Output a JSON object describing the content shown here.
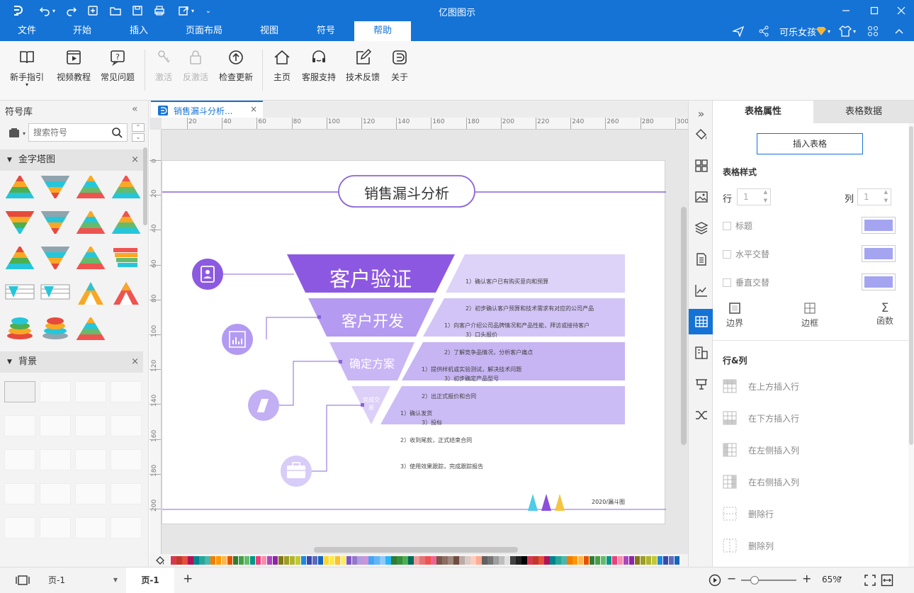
{
  "app": {
    "title": "亿图图示"
  },
  "menu": {
    "tabs": [
      {
        "label": "文件"
      },
      {
        "label": "开始"
      },
      {
        "label": "插入"
      },
      {
        "label": "页面布局"
      },
      {
        "label": "视图"
      },
      {
        "label": "符号"
      },
      {
        "label": "帮助"
      }
    ],
    "active_tab": "帮助",
    "user_name": "可乐女孩"
  },
  "ribbon": {
    "buttons": [
      {
        "label": "新手指引",
        "icon": "book-icon"
      },
      {
        "label": "视频教程",
        "icon": "video-icon"
      },
      {
        "label": "常见问题",
        "icon": "question-icon"
      },
      {
        "label": "激活",
        "icon": "key-icon",
        "disabled": true
      },
      {
        "label": "反激活",
        "icon": "lock-icon",
        "disabled": true
      },
      {
        "label": "检查更新",
        "icon": "upload-circle-icon"
      },
      {
        "label": "主页",
        "icon": "home-icon"
      },
      {
        "label": "客服支持",
        "icon": "headset-icon"
      },
      {
        "label": "技术反馈",
        "icon": "feedback-edit-icon"
      },
      {
        "label": "关于",
        "icon": "logo-icon"
      }
    ]
  },
  "symbol_library": {
    "title": "符号库",
    "search_placeholder": "搜索符号",
    "sections": [
      {
        "title": "金字塔图"
      },
      {
        "title": "背景"
      }
    ]
  },
  "doc_tab": {
    "label": "销售漏斗分析..."
  },
  "ruler": {
    "h_ticks": [
      "20",
      "40",
      "60",
      "80",
      "100",
      "120",
      "140",
      "160",
      "180",
      "200",
      "220",
      "240",
      "260",
      "280",
      "300"
    ],
    "v_ticks": [
      "0",
      "20",
      "40",
      "60",
      "80",
      "100",
      "120",
      "140",
      "160",
      "180",
      "200"
    ]
  },
  "diagram": {
    "title": "销售漏斗分析",
    "footer": "2020/漏斗图",
    "stages": [
      {
        "name": "客户验证",
        "lines": [
          "1）确认客户已有购买意向和预算",
          "2）初步确认客户预算和技术需求有对应的公司产品",
          "3）口头报价"
        ]
      },
      {
        "name": "客户开发",
        "lines": [
          "1）向客户介绍公司品牌情况和产品性能，拜访或接待客户",
          "2）了解竞争品情况，分析客户痛点",
          "3）初步确定产品型号"
        ]
      },
      {
        "name": "确定方案",
        "lines": [
          "1）提供样机或实验测试，解决技术问题",
          "2）出正式报价和合同",
          "3）投标"
        ]
      },
      {
        "name": "完成交易",
        "lines": [
          "1）确认发货",
          "2）收到尾款，正式结束合同",
          "3）使用效果跟踪，完成跟踪报告"
        ]
      }
    ],
    "colors": {
      "stage1": "#8d58e1",
      "stage2": "#b49af0",
      "stage3": "#c9b6f4",
      "stage4": "#dccff8",
      "desc_bg": "#ddd2f8",
      "line": "#8c64d8"
    }
  },
  "right_panel": {
    "tabs": [
      {
        "label": "表格属性"
      },
      {
        "label": "表格数据"
      }
    ],
    "insert_table": "插入表格",
    "table_style": "表格样式",
    "row_label": "行",
    "row_value": "1",
    "col_label": "列",
    "col_value": "1",
    "options": [
      {
        "label": "标题",
        "color": "#a4a4f0"
      },
      {
        "label": "水平交替",
        "color": "#a4a4f0"
      },
      {
        "label": "垂直交替",
        "color": "#a4a4f0"
      }
    ],
    "tools": [
      {
        "label": "边界"
      },
      {
        "label": "边框"
      },
      {
        "label": "函数"
      }
    ],
    "rowcol_title": "行&列",
    "rowcol_items": [
      {
        "label": "在上方插入行"
      },
      {
        "label": "在下方插入行"
      },
      {
        "label": "在左侧插入列"
      },
      {
        "label": "在右侧插入列"
      },
      {
        "label": "删除行"
      },
      {
        "label": "删除列"
      }
    ]
  },
  "status": {
    "page_select": "页-1",
    "page_tab": "页-1",
    "add": "+",
    "zoom": "65%"
  }
}
